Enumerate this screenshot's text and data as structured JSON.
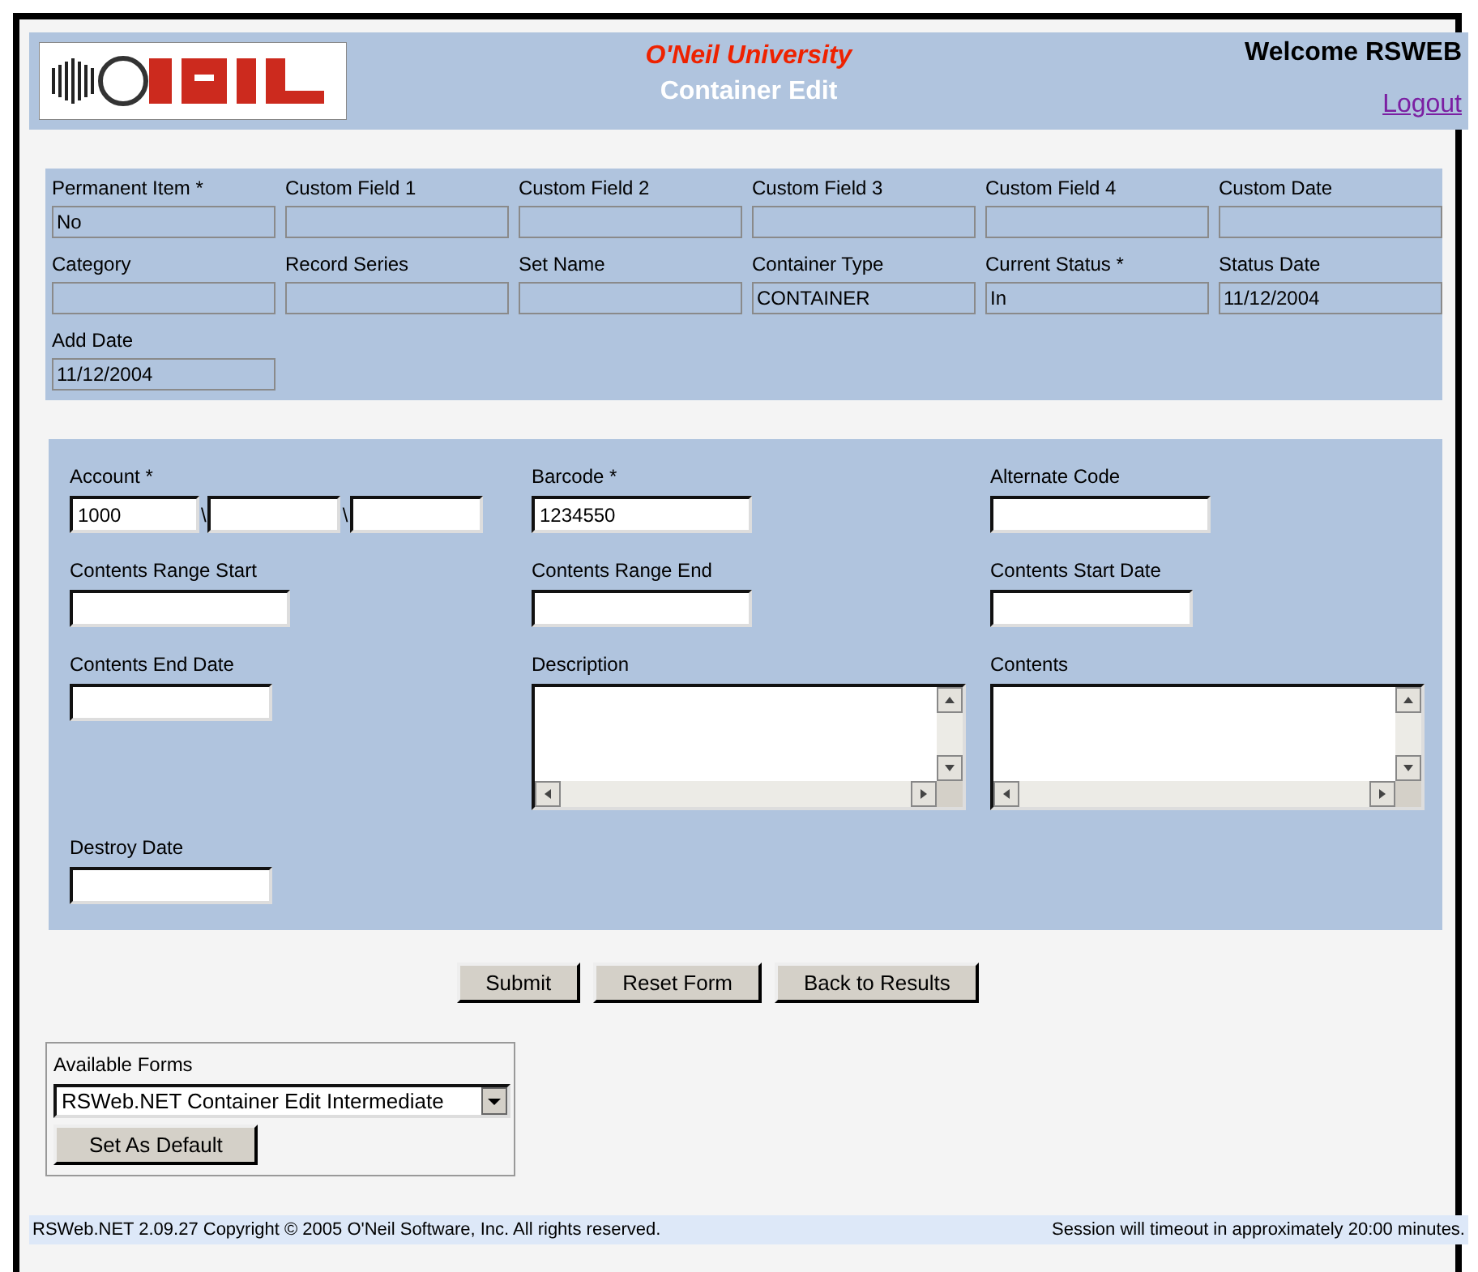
{
  "header": {
    "organization": "O'Neil University",
    "title": "Container Edit",
    "welcome": "Welcome RSWEB",
    "logout": "Logout"
  },
  "summary": {
    "fields": [
      {
        "label": "Permanent Item *",
        "value": "No"
      },
      {
        "label": "Custom Field 1"
      },
      {
        "label": "Custom Field 2"
      },
      {
        "label": "Custom Field 3"
      },
      {
        "label": "Custom Field 4"
      },
      {
        "label": "Custom Date"
      },
      {
        "label": "Category"
      },
      {
        "label": "Record Series"
      },
      {
        "label": "Set Name"
      },
      {
        "label": "Container Type",
        "value": "CONTAINER"
      },
      {
        "label": "Current Status *",
        "value": "In"
      },
      {
        "label": "Status Date",
        "value": "11/12/2004"
      },
      {
        "label": "Add Date",
        "value": "11/12/2004"
      }
    ]
  },
  "form": {
    "fields": [
      {
        "kind": "account",
        "label": "Account *",
        "segments": [
          {
            "value": "1000"
          },
          {
            "prefix": "\\"
          },
          {
            "prefix": "\\"
          }
        ]
      },
      {
        "kind": "text",
        "label": "Barcode *",
        "value": "1234550"
      },
      {
        "kind": "text",
        "label": "Alternate Code"
      },
      {
        "kind": "text",
        "label": "Contents Range Start"
      },
      {
        "kind": "text",
        "label": "Contents Range End"
      },
      {
        "kind": "date",
        "label": "Contents Start Date"
      },
      {
        "kind": "date",
        "label": "Contents End Date"
      },
      {
        "kind": "textarea",
        "label": "Description"
      },
      {
        "kind": "textarea",
        "label": "Contents"
      },
      {
        "kind": "date",
        "label": "Destroy Date"
      }
    ]
  },
  "buttons": [
    "Submit",
    "Reset Form",
    "Back to Results"
  ],
  "available_forms": {
    "label": "Available Forms",
    "selected_form": "RSWeb.NET Container Edit Intermediate",
    "button": "Set As Default"
  },
  "status_bar": {
    "copyright": "RSWeb.NET 2.09.27 Copyright © 2005 O'Neil Software, Inc. All rights reserved.",
    "session": "Session will timeout in approximately 20:00 minutes."
  }
}
